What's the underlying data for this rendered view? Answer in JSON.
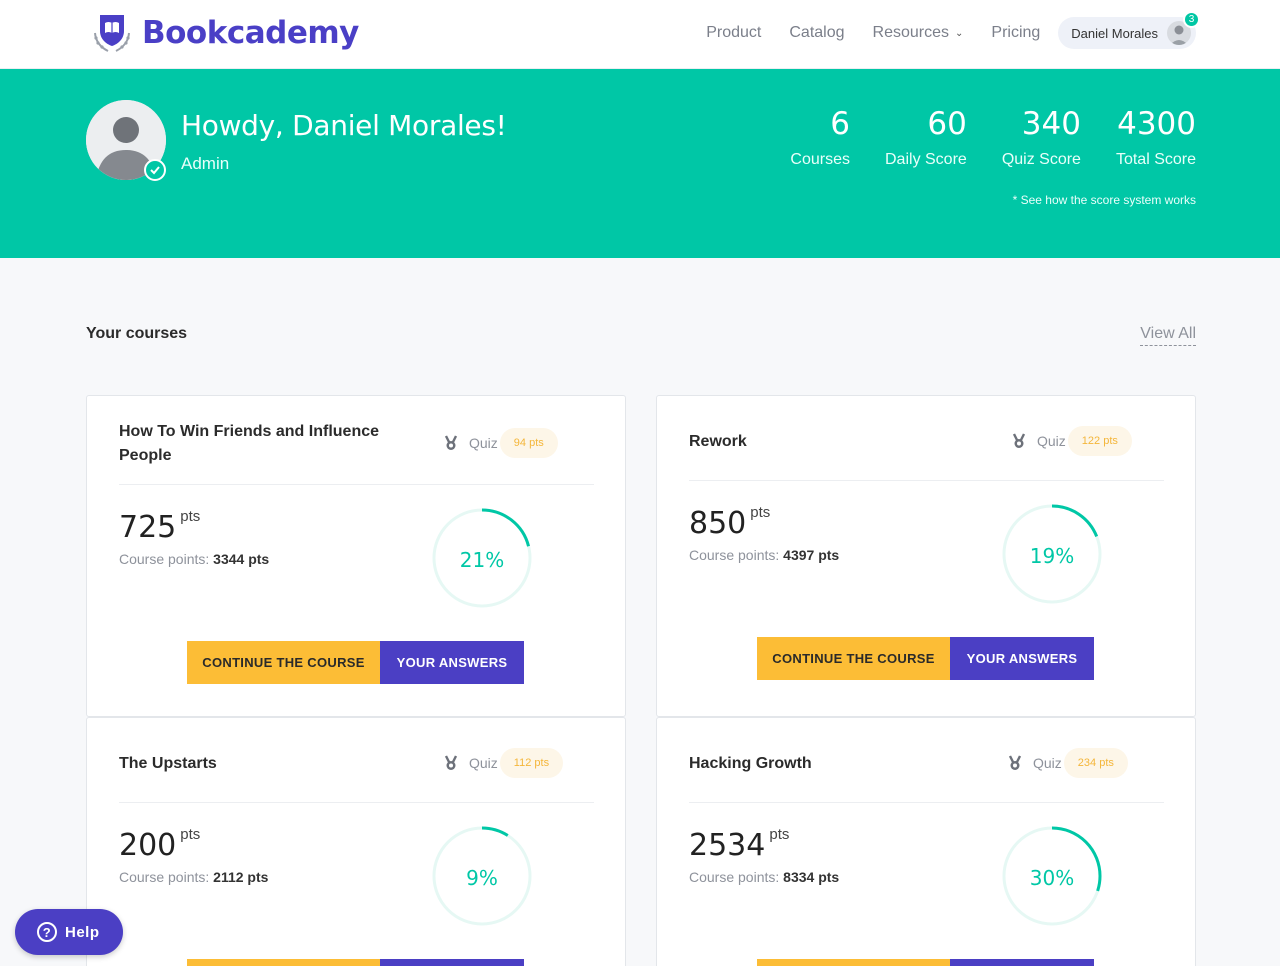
{
  "brand": {
    "name": "Bookcademy",
    "color": "#4a3fc6"
  },
  "nav": {
    "items": [
      {
        "label": "Product"
      },
      {
        "label": "Catalog"
      },
      {
        "label": "Resources"
      },
      {
        "label": "Pricing"
      }
    ],
    "user": {
      "name": "Daniel Morales",
      "notifications": "3"
    }
  },
  "hero": {
    "greeting": "Howdy, Daniel Morales!",
    "role": "Admin",
    "stats": [
      {
        "value": "6",
        "label": "Courses"
      },
      {
        "value": "60",
        "label": "Daily Score"
      },
      {
        "value": "340",
        "label": "Quiz Score"
      },
      {
        "value": "4300",
        "label": "Total Score"
      }
    ],
    "note": "* See how the score system works"
  },
  "section": {
    "title": "Your courses",
    "view_all": "View All"
  },
  "labels": {
    "quiz": "Quiz",
    "pts_unit": "pts",
    "course_points": "Course points:",
    "continue": "CONTINUE THE COURSE",
    "answers": "YOUR ANSWERS"
  },
  "courses": [
    {
      "title": "How To Win Friends and Influence People",
      "quiz_pts": "94 pts",
      "points": "725",
      "course_points": "3344 pts",
      "progress": 21,
      "progress_label": "21%"
    },
    {
      "title": "Rework",
      "quiz_pts": "122 pts",
      "points": "850",
      "course_points": "4397 pts",
      "progress": 19,
      "progress_label": "19%"
    },
    {
      "title": "The Upstarts",
      "quiz_pts": "112 pts",
      "points": "200",
      "course_points": "2112 pts",
      "progress": 9,
      "progress_label": "9%"
    },
    {
      "title": "Hacking Growth",
      "quiz_pts": "234 pts",
      "points": "2534",
      "course_points": "8334 pts",
      "progress": 30,
      "progress_label": "30%"
    }
  ],
  "help": {
    "label": "Help"
  },
  "colors": {
    "accent": "#00c7a6",
    "primary": "#4b3fc4",
    "yellow": "#fcbd36"
  }
}
